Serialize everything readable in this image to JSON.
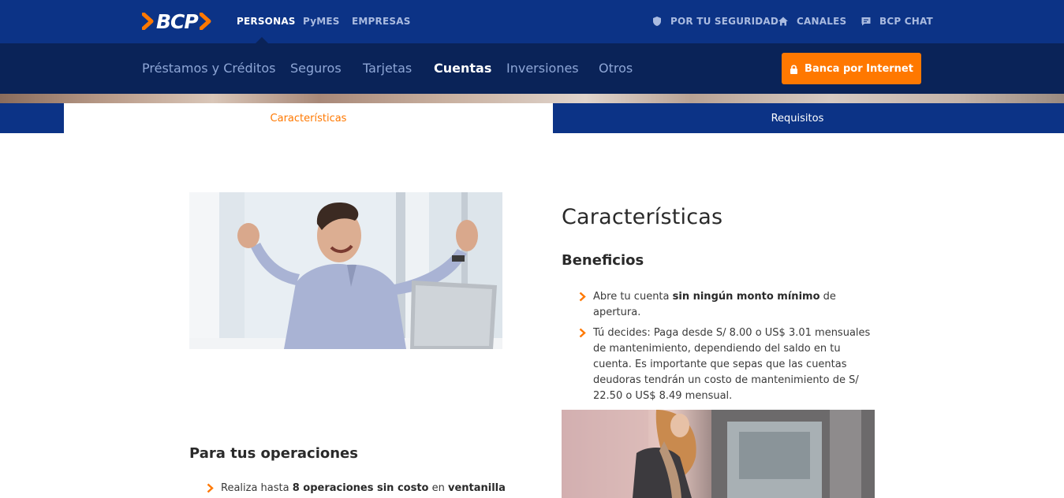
{
  "header": {
    "brand": "BCP",
    "segments": [
      {
        "label": "PERSONAS",
        "active": true
      },
      {
        "label": "PyMES",
        "active": false
      },
      {
        "label": "EMPRESAS",
        "active": false
      }
    ],
    "utilities": [
      {
        "label": "POR TU SEGURIDAD",
        "icon": "shield-icon"
      },
      {
        "label": "CANALES",
        "icon": "home-icon"
      },
      {
        "label": "BCP CHAT",
        "icon": "chat-icon"
      }
    ]
  },
  "product_nav": {
    "items": [
      {
        "label": "Préstamos y Créditos",
        "active": false
      },
      {
        "label": "Seguros",
        "active": false
      },
      {
        "label": "Tarjetas",
        "active": false
      },
      {
        "label": "Cuentas",
        "active": true
      },
      {
        "label": "Inversiones",
        "active": false
      },
      {
        "label": "Otros",
        "active": false
      }
    ],
    "cta_label": "Banca por Internet",
    "cta_icon": "lock-icon"
  },
  "tabs": [
    {
      "label": "Características",
      "active": true
    },
    {
      "label": "Requisitos",
      "active": false
    }
  ],
  "content": {
    "title": "Características",
    "benefits_title": "Beneficios",
    "benefits": [
      {
        "pre": "Abre tu cuenta ",
        "bold": "sin ningún monto mínimo",
        "post": " de apertura."
      },
      {
        "pre": "Tú decides: Paga desde S/ 8.00 o US$ 3.01 mensuales de mantenimiento, dependiendo del saldo en tu cuenta. Es importante que sepas que las cuentas deudoras tendrán un costo de mantenimiento de S/ 22.50 o US$ 8.49 mensual.",
        "bold": "",
        "post": ""
      }
    ],
    "operations_title": "Para tus operaciones",
    "operations": [
      {
        "pre": "Realiza hasta ",
        "bold": "8 operaciones sin costo",
        "mid": " en ",
        "bold2": "ventanilla"
      }
    ]
  },
  "colors": {
    "brand_blue": "#0c3386",
    "nav_dark": "#0a2358",
    "accent_orange": "#ff7800"
  }
}
